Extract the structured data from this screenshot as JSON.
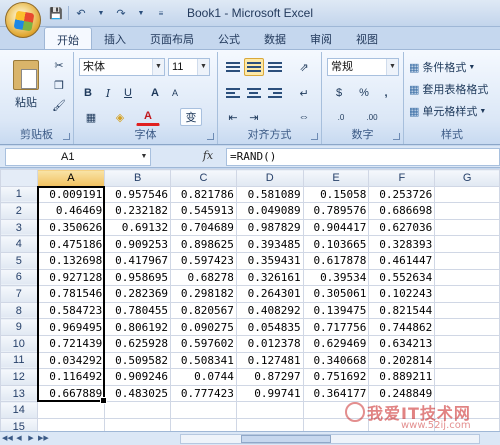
{
  "window": {
    "title": "Book1 - Microsoft Excel"
  },
  "qat": {
    "save_icon": "save-icon",
    "undo_icon": "undo-icon",
    "redo_icon": "redo-icon"
  },
  "tabs": [
    {
      "label": "开始",
      "active": true
    },
    {
      "label": "插入"
    },
    {
      "label": "页面布局"
    },
    {
      "label": "公式"
    },
    {
      "label": "数据"
    },
    {
      "label": "审阅"
    },
    {
      "label": "视图"
    }
  ],
  "ribbon": {
    "clipboard": {
      "paste_label": "粘贴",
      "group_label": "剪贴板"
    },
    "font": {
      "font_name": "宋体",
      "font_size": "11",
      "bold": "B",
      "italic": "I",
      "underline": "U",
      "grow": "A",
      "shrink": "A",
      "phonetic": "变",
      "font_color": "A",
      "group_label": "字体"
    },
    "alignment": {
      "group_label": "对齐方式"
    },
    "number": {
      "format": "常规",
      "currency": "$",
      "percent": "%",
      "comma": ",",
      "inc_decimal": ".0",
      "dec_decimal": ".00",
      "group_label": "数字"
    },
    "styles": {
      "conditional": "条件格式",
      "table": "套用表格格式",
      "cell": "单元格样式",
      "group_label": "样式"
    }
  },
  "formula_bar": {
    "name_box": "A1",
    "fx": "fx",
    "formula": "=RAND()"
  },
  "sheet": {
    "columns": [
      "A",
      "B",
      "C",
      "D",
      "E",
      "F",
      "G"
    ],
    "selected_column": "A",
    "rows": [
      [
        "0.009191",
        "0.957546",
        "0.821786",
        "0.581089",
        "0.15058",
        "0.253726",
        ""
      ],
      [
        "0.46469",
        "0.232182",
        "0.545913",
        "0.049089",
        "0.789576",
        "0.686698",
        ""
      ],
      [
        "0.350626",
        "0.69132",
        "0.704689",
        "0.987829",
        "0.904417",
        "0.627036",
        ""
      ],
      [
        "0.475186",
        "0.909253",
        "0.898625",
        "0.393485",
        "0.103665",
        "0.328393",
        ""
      ],
      [
        "0.132698",
        "0.417967",
        "0.597423",
        "0.359431",
        "0.617878",
        "0.461447",
        ""
      ],
      [
        "0.927128",
        "0.958695",
        "0.68278",
        "0.326161",
        "0.39534",
        "0.552634",
        ""
      ],
      [
        "0.781546",
        "0.282369",
        "0.298182",
        "0.264301",
        "0.305061",
        "0.102243",
        ""
      ],
      [
        "0.584723",
        "0.780455",
        "0.820567",
        "0.408292",
        "0.139475",
        "0.821544",
        ""
      ],
      [
        "0.969495",
        "0.806192",
        "0.090275",
        "0.054835",
        "0.717756",
        "0.744862",
        ""
      ],
      [
        "0.721439",
        "0.625928",
        "0.597602",
        "0.012378",
        "0.629469",
        "0.634213",
        ""
      ],
      [
        "0.034292",
        "0.509582",
        "0.508341",
        "0.127481",
        "0.340668",
        "0.202814",
        ""
      ],
      [
        "0.116492",
        "0.909246",
        "0.0744",
        "0.87297",
        "0.751692",
        "0.889211",
        ""
      ],
      [
        "0.667889",
        "0.483025",
        "0.777423",
        "0.99741",
        "0.364177",
        "0.248849",
        ""
      ],
      [
        "",
        "",
        "",
        "",
        "",
        "",
        ""
      ],
      [
        "",
        "",
        "",
        "",
        "",
        "",
        ""
      ]
    ]
  },
  "watermark": {
    "text": "我爱IT技术网",
    "url": "www.52ij.com"
  }
}
